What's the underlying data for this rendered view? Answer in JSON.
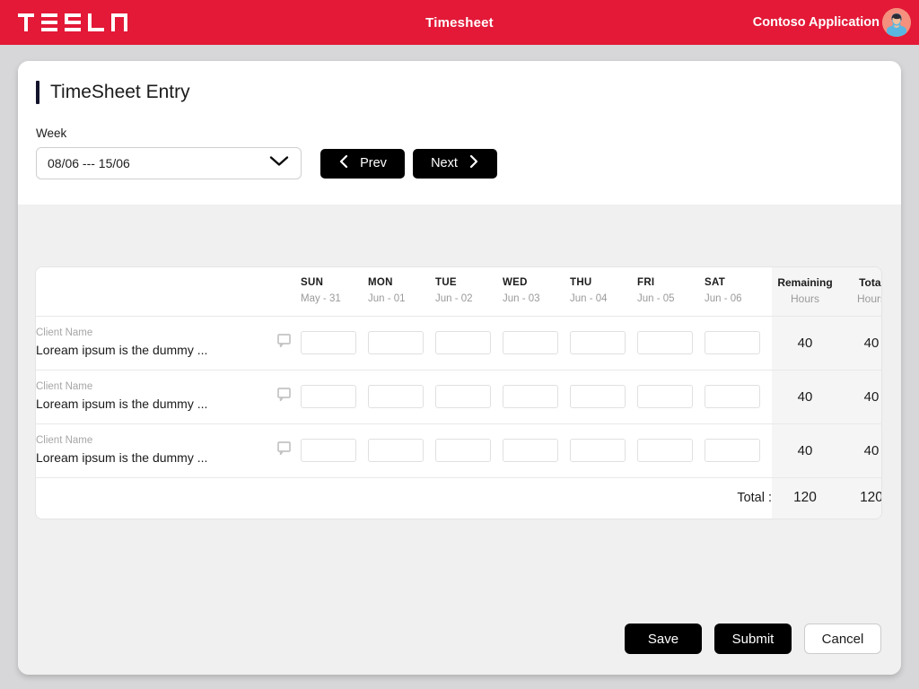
{
  "topbar": {
    "brand": "TESLA",
    "title": "Timesheet",
    "app_name": "Contoso Application",
    "avatar_icon": "user-avatar-icon",
    "bg_color": "#e31937"
  },
  "page": {
    "title": "TimeSheet Entry",
    "accent_bar_color": "#13142b"
  },
  "week_picker": {
    "label": "Week",
    "value": "08/06 --- 15/06",
    "chevron_icon": "chevron-down-icon"
  },
  "nav": {
    "prev_label": "Prev",
    "next_label": "Next",
    "prev_icon": "chevron-left-icon",
    "next_icon": "chevron-right-icon"
  },
  "table": {
    "columns": [
      {
        "dow": "SUN",
        "date": "May - 31"
      },
      {
        "dow": "MON",
        "date": "Jun - 01"
      },
      {
        "dow": "TUE",
        "date": "Jun - 02"
      },
      {
        "dow": "WED",
        "date": "Jun - 03"
      },
      {
        "dow": "THU",
        "date": "Jun - 04"
      },
      {
        "dow": "FRI",
        "date": "Jun - 05"
      },
      {
        "dow": "SAT",
        "date": "Jun - 06"
      }
    ],
    "remaining_header": {
      "line1": "Remaining",
      "line2": "Hours"
    },
    "total_header": {
      "line1": "Total",
      "line2": "Hours"
    },
    "comment_icon": "comment-bubble-icon",
    "rows": [
      {
        "client_label": "Client Name",
        "task_name": "Loream ipsum is the dummy ...",
        "hours": [
          "",
          "",
          "",
          "",
          "",
          "",
          ""
        ],
        "remaining": "40",
        "total": "40"
      },
      {
        "client_label": "Client Name",
        "task_name": "Loream ipsum is the dummy ...",
        "hours": [
          "",
          "",
          "",
          "",
          "",
          "",
          ""
        ],
        "remaining": "40",
        "total": "40"
      },
      {
        "client_label": "Client Name",
        "task_name": "Loream ipsum is the dummy ...",
        "hours": [
          "",
          "",
          "",
          "",
          "",
          "",
          ""
        ],
        "remaining": "40",
        "total": "40"
      }
    ],
    "footer": {
      "label": "Total :",
      "remaining": "120",
      "total": "120"
    },
    "hour_input_placeholder": ""
  },
  "actions": {
    "save": "Save",
    "submit": "Submit",
    "cancel": "Cancel"
  }
}
